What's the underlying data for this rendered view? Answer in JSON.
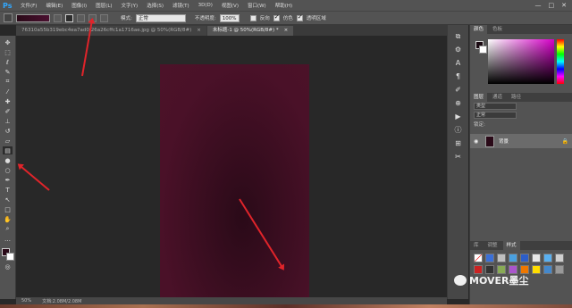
{
  "app": {
    "logo": "Ps"
  },
  "menu": [
    "文件(F)",
    "编辑(E)",
    "图像(I)",
    "图层(L)",
    "文字(Y)",
    "选择(S)",
    "滤镜(T)",
    "3D(D)",
    "视图(V)",
    "窗口(W)",
    "帮助(H)"
  ],
  "window_controls": [
    "—",
    "□",
    "✕"
  ],
  "options": {
    "mode_label": "模式:",
    "mode_value": "正常",
    "opacity_label": "不透明度:",
    "opacity_value": "100%",
    "reverse_label": "反向",
    "dither_label": "仿色",
    "transparency_label": "透明区域"
  },
  "tabs": [
    {
      "label": "76310a55b319ebc4ea7ad0f26a26cffc1a1716ae.jpg @ 50%(RGB/8#)",
      "close": "×",
      "active": false
    },
    {
      "label": "未标题-1 @ 50%(RGB/8#) *",
      "close": "×",
      "active": true
    }
  ],
  "status": {
    "zoom": "50%",
    "doc": "文档:2.08M/2.08M"
  },
  "color_panel": {
    "tabs": [
      "颜色",
      "色板"
    ]
  },
  "layers_panel": {
    "tabs": [
      "图层",
      "通道",
      "路径"
    ],
    "kind_label": "类型",
    "blend_mode": "正常",
    "lock_label": "锁定:",
    "layer_name": "背景"
  },
  "styles_panel": {
    "tabs": [
      "库",
      "调整",
      "样式"
    ]
  },
  "watermark": "MOVER墨尘",
  "colors": {
    "canvas": "#4c1229",
    "annotation_arrow": "#e0242a",
    "accent": "#31a8ff"
  }
}
